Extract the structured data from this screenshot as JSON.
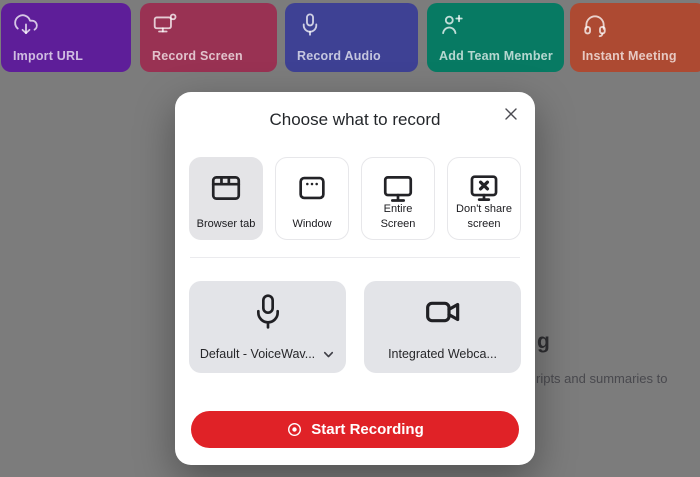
{
  "colors": {
    "overlay_gray": "#7c7c7c",
    "accent_red": "#e02227",
    "selected_option_bg": "#e4e4e7",
    "device_card_bg": "#e3e4e8"
  },
  "background": {
    "action_cards": [
      {
        "label": "Import URL",
        "icon": "cloud-download-icon",
        "bg": "#5e1e99"
      },
      {
        "label": "Record Screen",
        "icon": "screen-record-icon",
        "bg": "#993253"
      },
      {
        "label": "Record Audio",
        "icon": "microphone-icon",
        "bg": "#3e4194"
      },
      {
        "label": "Add Team Member",
        "icon": "user-plus-icon",
        "bg": "#077a63"
      },
      {
        "label": "Instant Meeting",
        "icon": "headset-icon",
        "bg": "#ad4a32"
      }
    ],
    "heading_fragment": "g",
    "paragraph_fragment": "ripts and summaries to"
  },
  "modal": {
    "title": "Choose what to record",
    "source_options": [
      {
        "label": "Browser tab",
        "icon": "browser-tab-icon",
        "selected": true
      },
      {
        "label": "Window",
        "icon": "window-icon",
        "selected": false
      },
      {
        "label": "Entire Screen",
        "icon": "monitor-icon",
        "selected": false
      },
      {
        "label": "Don't share screen",
        "icon": "monitor-x-icon",
        "selected": false
      }
    ],
    "devices": [
      {
        "label": "Default - VoiceWav...",
        "icon": "microphone-icon",
        "dropdown": true
      },
      {
        "label": "Integrated Webca...",
        "icon": "video-camera-icon",
        "dropdown": false
      }
    ],
    "start_button": {
      "label": "Start Recording",
      "icon": "record-dot-icon"
    }
  }
}
